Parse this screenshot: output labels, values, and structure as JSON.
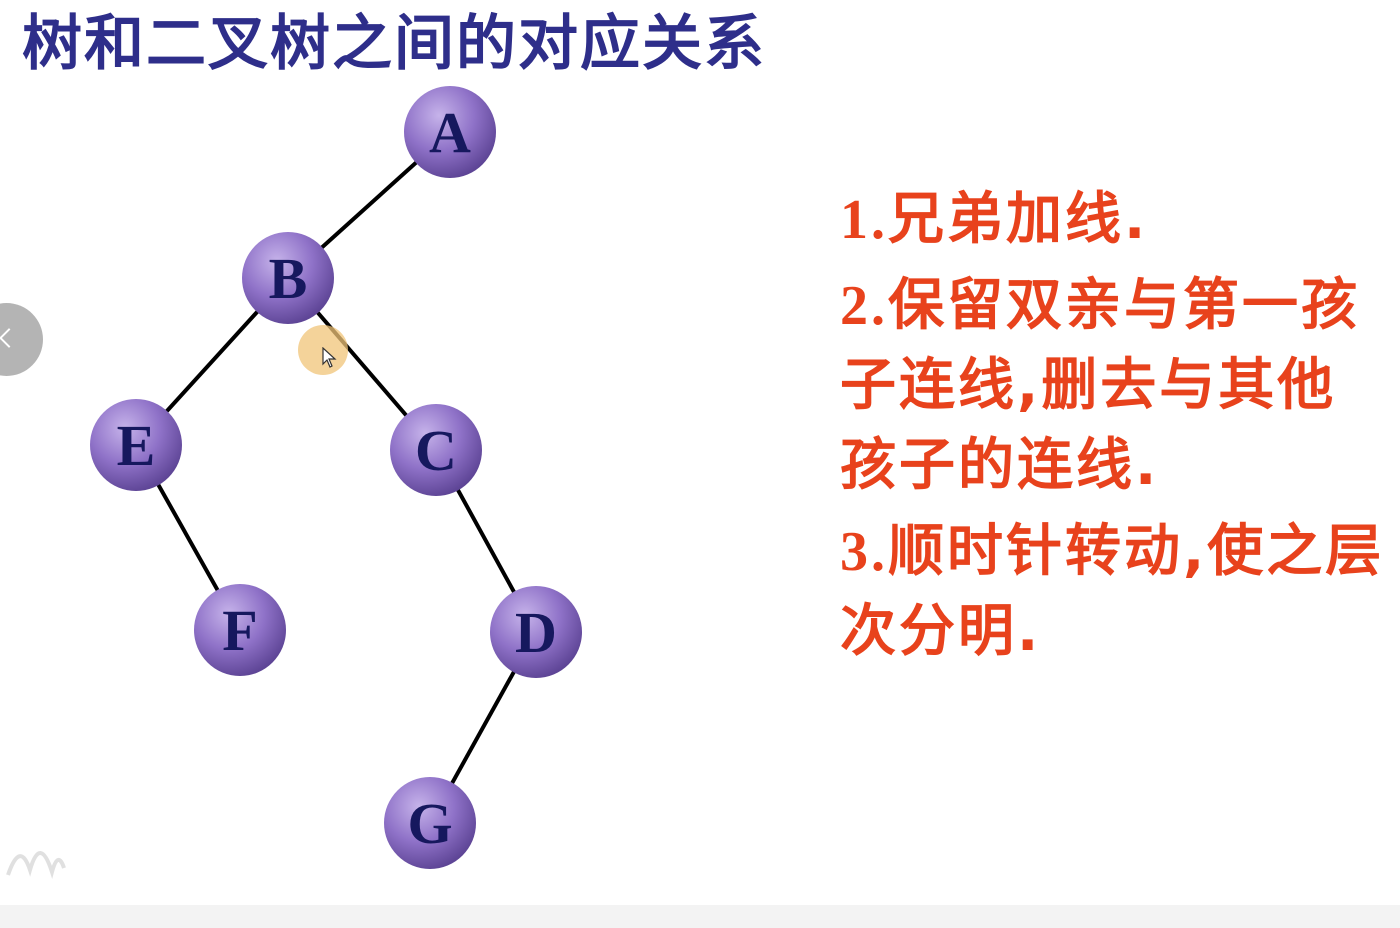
{
  "title": "树和二叉树之间的对应关系",
  "tree": {
    "nodes": [
      {
        "id": "A",
        "label": "A"
      },
      {
        "id": "B",
        "label": "B"
      },
      {
        "id": "E",
        "label": "E"
      },
      {
        "id": "C",
        "label": "C"
      },
      {
        "id": "F",
        "label": "F"
      },
      {
        "id": "D",
        "label": "D"
      },
      {
        "id": "G",
        "label": "G"
      }
    ],
    "edges": [
      {
        "from": "A",
        "to": "B"
      },
      {
        "from": "B",
        "to": "E"
      },
      {
        "from": "B",
        "to": "C"
      },
      {
        "from": "E",
        "to": "F"
      },
      {
        "from": "C",
        "to": "D"
      },
      {
        "from": "D",
        "to": "G"
      }
    ],
    "node_color": "#8a6cc4",
    "label_color": "#16185e"
  },
  "steps": [
    {
      "num": "1.",
      "text": "兄弟加线."
    },
    {
      "num": "2.",
      "text": "保留双亲与第一孩子连线,删去与其他孩子的连线."
    },
    {
      "num": "3.",
      "text": "顺时针转动,使之层次分明."
    }
  ],
  "colors": {
    "title": "#2e2e8a",
    "steps": "#e8421c"
  },
  "icons": {
    "nav_prev": "chevron-left-icon",
    "cursor": "mouse-cursor-icon"
  }
}
